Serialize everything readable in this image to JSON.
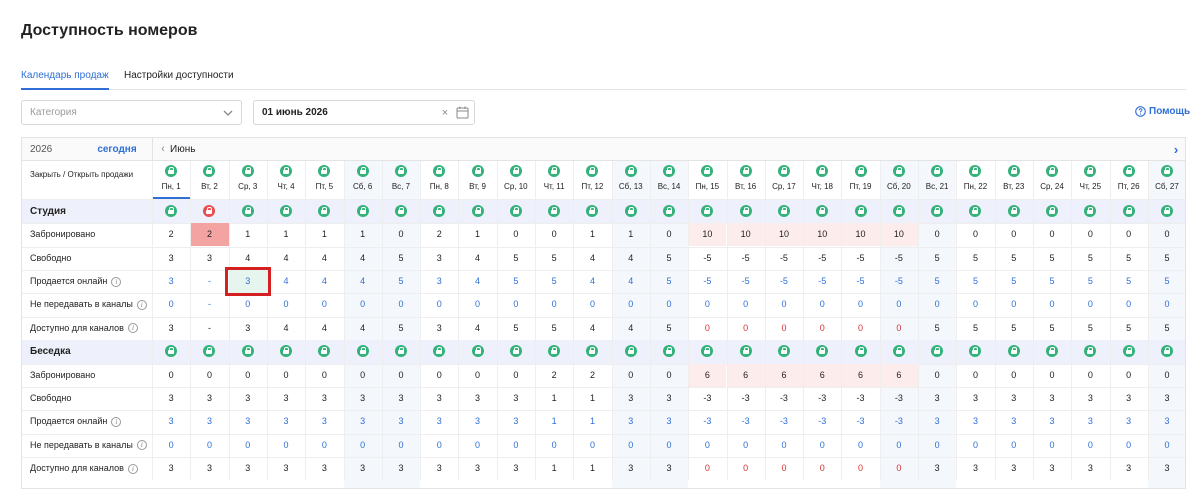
{
  "page_title": "Доступность номеров",
  "tabs": [
    "Календарь продаж",
    "Настройки доступности"
  ],
  "filters": {
    "category_placeholder": "Категория",
    "date_value": "01 июнь 2026",
    "help_label": "Помощь"
  },
  "calendar": {
    "year": "2026",
    "today_label": "сегодня",
    "month_label": "Июнь",
    "close_open_label": "Закрыть / Открыть продажи",
    "days": [
      "Пн, 1",
      "Вт, 2",
      "Ср, 3",
      "Чт, 4",
      "Пт, 5",
      "Сб, 6",
      "Вс, 7",
      "Пн, 8",
      "Вт, 9",
      "Ср, 10",
      "Чт, 11",
      "Пт, 12",
      "Сб, 13",
      "Вс, 14",
      "Пн, 15",
      "Вт, 16",
      "Ср, 17",
      "Чт, 18",
      "Пт, 19",
      "Сб, 20",
      "Вс, 21",
      "Пн, 22",
      "Вт, 23",
      "Ср, 24",
      "Чт, 25",
      "Пт, 26",
      "Сб, 27"
    ],
    "weekend_indexes": [
      5,
      6,
      12,
      13,
      19,
      20,
      26
    ]
  },
  "categories": [
    {
      "name": "Студия",
      "closed_days": [
        1
      ],
      "rows": [
        {
          "label": "Забронировано",
          "info": false,
          "style": "plain",
          "values": [
            "2",
            "2",
            "1",
            "1",
            "1",
            "1",
            "0",
            "2",
            "1",
            "0",
            "0",
            "1",
            "1",
            "0",
            "10",
            "10",
            "10",
            "10",
            "10",
            "10",
            "0",
            "0",
            "0",
            "0",
            "0",
            "0",
            "0"
          ]
        },
        {
          "label": "Свободно",
          "info": false,
          "style": "plain",
          "values": [
            "3",
            "3",
            "4",
            "4",
            "4",
            "4",
            "5",
            "3",
            "4",
            "5",
            "5",
            "4",
            "4",
            "5",
            "-5",
            "-5",
            "-5",
            "-5",
            "-5",
            "-5",
            "5",
            "5",
            "5",
            "5",
            "5",
            "5",
            "5"
          ]
        },
        {
          "label": "Продается онлайн",
          "info": true,
          "style": "blue",
          "values": [
            "3",
            "-",
            "3",
            "4",
            "4",
            "4",
            "5",
            "3",
            "4",
            "5",
            "5",
            "4",
            "4",
            "5",
            "-5",
            "-5",
            "-5",
            "-5",
            "-5",
            "-5",
            "5",
            "5",
            "5",
            "5",
            "5",
            "5",
            "5"
          ]
        },
        {
          "label": "Не передавать в каналы",
          "info": true,
          "style": "blue",
          "values": [
            "0",
            "-",
            "0",
            "0",
            "0",
            "0",
            "0",
            "0",
            "0",
            "0",
            "0",
            "0",
            "0",
            "0",
            "0",
            "0",
            "0",
            "0",
            "0",
            "0",
            "0",
            "0",
            "0",
            "0",
            "0",
            "0",
            "0"
          ]
        },
        {
          "label": "Доступно для каналов",
          "info": true,
          "style": "channels",
          "values": [
            "3",
            "-",
            "3",
            "4",
            "4",
            "4",
            "5",
            "3",
            "4",
            "5",
            "5",
            "4",
            "4",
            "5",
            "0",
            "0",
            "0",
            "0",
            "0",
            "0",
            "5",
            "5",
            "5",
            "5",
            "5",
            "5",
            "5"
          ]
        }
      ]
    },
    {
      "name": "Беседка",
      "closed_days": [],
      "rows": [
        {
          "label": "Забронировано",
          "info": false,
          "style": "plain",
          "values": [
            "0",
            "0",
            "0",
            "0",
            "0",
            "0",
            "0",
            "0",
            "0",
            "0",
            "2",
            "2",
            "0",
            "0",
            "6",
            "6",
            "6",
            "6",
            "6",
            "6",
            "0",
            "0",
            "0",
            "0",
            "0",
            "0",
            "0"
          ]
        },
        {
          "label": "Свободно",
          "info": false,
          "style": "plain",
          "values": [
            "3",
            "3",
            "3",
            "3",
            "3",
            "3",
            "3",
            "3",
            "3",
            "3",
            "1",
            "1",
            "3",
            "3",
            "-3",
            "-3",
            "-3",
            "-3",
            "-3",
            "-3",
            "3",
            "3",
            "3",
            "3",
            "3",
            "3",
            "3"
          ]
        },
        {
          "label": "Продается онлайн",
          "info": true,
          "style": "blue",
          "values": [
            "3",
            "3",
            "3",
            "3",
            "3",
            "3",
            "3",
            "3",
            "3",
            "3",
            "1",
            "1",
            "3",
            "3",
            "-3",
            "-3",
            "-3",
            "-3",
            "-3",
            "-3",
            "3",
            "3",
            "3",
            "3",
            "3",
            "3",
            "3"
          ]
        },
        {
          "label": "Не передавать в каналы",
          "info": true,
          "style": "blue",
          "values": [
            "0",
            "0",
            "0",
            "0",
            "0",
            "0",
            "0",
            "0",
            "0",
            "0",
            "0",
            "0",
            "0",
            "0",
            "0",
            "0",
            "0",
            "0",
            "0",
            "0",
            "0",
            "0",
            "0",
            "0",
            "0",
            "0",
            "0"
          ]
        },
        {
          "label": "Доступно для каналов",
          "info": true,
          "style": "channels",
          "values": [
            "3",
            "3",
            "3",
            "3",
            "3",
            "3",
            "3",
            "3",
            "3",
            "3",
            "1",
            "1",
            "3",
            "3",
            "0",
            "0",
            "0",
            "0",
            "0",
            "0",
            "3",
            "3",
            "3",
            "3",
            "3",
            "3",
            "3"
          ]
        }
      ]
    }
  ],
  "highlighted_cell": {
    "category": 0,
    "row": 2,
    "day": 2
  },
  "colors": {
    "accent": "#2f6fd6",
    "open_lock": "#33b27a",
    "closed_lock": "#ea4d4d",
    "overbooked_bg": "#fdecec",
    "overbooked_strong_bg": "#f4a3a3",
    "category_row_bg": "#eef1fb",
    "weekend_bg": "#f4f7fb",
    "highlight_border": "#d42020",
    "highlight_bg": "#e6f6ee"
  }
}
